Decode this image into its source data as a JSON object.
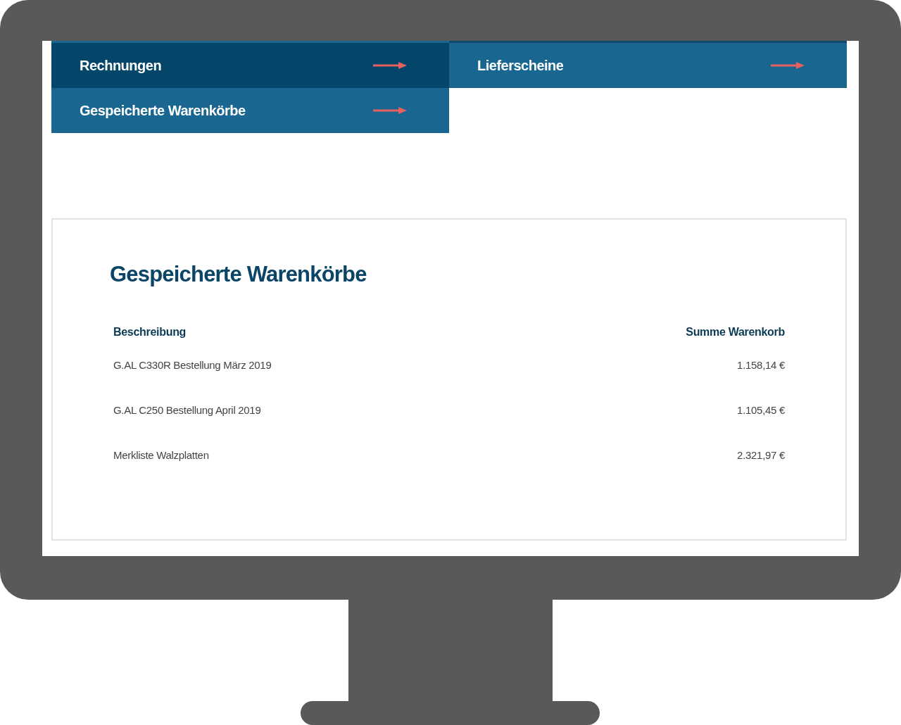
{
  "tiles": [
    {
      "label": "Rechnungen",
      "selected": true
    },
    {
      "label": "Lieferscheine",
      "selected": false
    },
    {
      "label": "Gespeicherte Warenkörbe",
      "selected": false
    }
  ],
  "panel": {
    "title": "Gespeicherte Warenkörbe",
    "table": {
      "columns": [
        "Beschreibung",
        "Summe Warenkorb"
      ],
      "rows": [
        {
          "description": "G.AL C330R Bestellung März 2019",
          "total": "1.158,14 €"
        },
        {
          "description": "G.AL C250 Bestellung April 2019",
          "total": "1.105,45 €"
        },
        {
          "description": "Merkliste Walzplatten",
          "total": "2.321,97 €"
        }
      ]
    }
  }
}
